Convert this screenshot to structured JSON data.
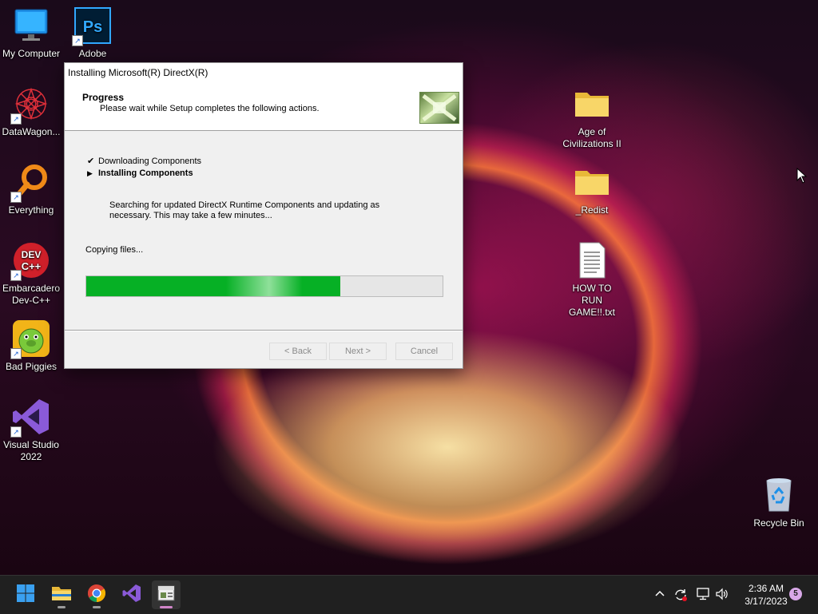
{
  "desktop": {
    "left_icons": [
      {
        "label": "My Computer",
        "icon": "monitor-icon"
      },
      {
        "label": "Adobe Photosh...",
        "icon": "photoshop-icon"
      },
      {
        "label": "DataWagon...",
        "icon": "datawagon-icon"
      },
      {
        "label": "Everything",
        "icon": "everything-search-icon"
      },
      {
        "label": "Embarcadero Dev-C++",
        "icon": "devcpp-icon"
      },
      {
        "label": "Bad Piggies",
        "icon": "bad-piggies-icon"
      },
      {
        "label": "Visual Studio 2022",
        "icon": "visual-studio-icon"
      }
    ],
    "right_icons": [
      {
        "label": "Age of Civilizations II",
        "icon": "folder-icon"
      },
      {
        "label": "_Redist",
        "icon": "folder-icon"
      },
      {
        "label": "HOW TO RUN GAME!!.txt",
        "icon": "text-file-icon"
      },
      {
        "label": "Recycle Bin",
        "icon": "recycle-bin-icon"
      }
    ]
  },
  "dialog": {
    "title": "Installing Microsoft(R) DirectX(R)",
    "header_title": "Progress",
    "header_subtitle": "Please wait while Setup completes the following actions.",
    "steps": [
      {
        "marker": "✔",
        "label": "Downloading Components",
        "state": "done"
      },
      {
        "marker": "▶",
        "label": "Installing Components",
        "state": "current"
      }
    ],
    "description": "Searching for updated DirectX Runtime Components and updating as necessary. This may take a few minutes...",
    "status": "Copying files...",
    "progress_fraction": 0.714,
    "progress_color": "#06b025",
    "buttons": {
      "back": "< Back",
      "next": "Next >",
      "cancel": "Cancel"
    }
  },
  "taskbar": {
    "pinned": [
      {
        "name": "start",
        "icon": "windows-start-icon"
      },
      {
        "name": "file-explorer",
        "icon": "folder-icon"
      },
      {
        "name": "chrome",
        "icon": "chrome-icon"
      },
      {
        "name": "visual-studio",
        "icon": "visual-studio-icon"
      },
      {
        "name": "directx-setup",
        "icon": "setup-window-icon"
      }
    ],
    "tray_icons": [
      "chevron-up-icon",
      "sync-icon",
      "network-icon",
      "volume-icon"
    ],
    "time": "2:36 AM",
    "date": "3/17/2023",
    "notification_count": "5"
  }
}
